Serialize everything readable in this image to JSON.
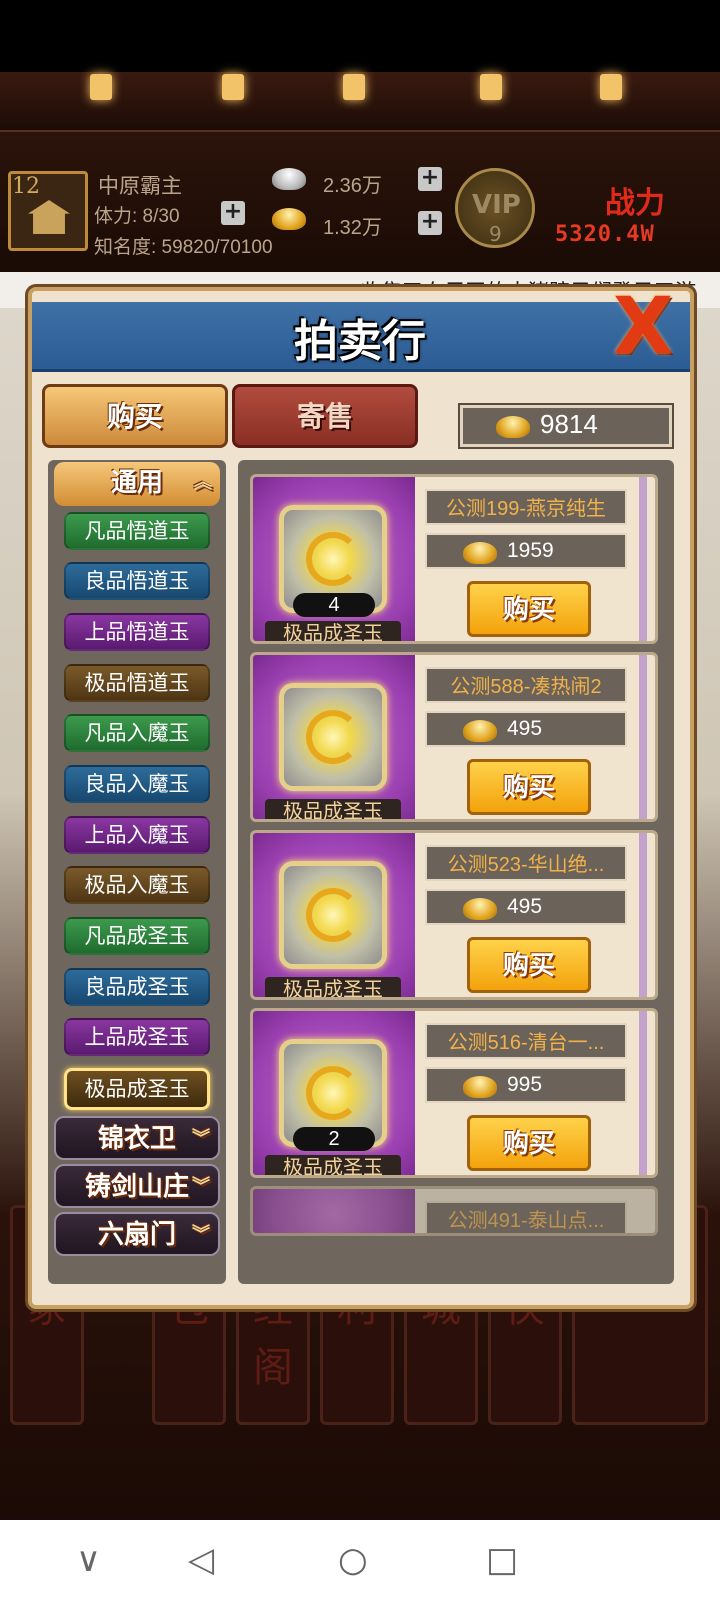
{
  "hud": {
    "level": "12",
    "player_name": "中原霸主",
    "stamina": "体力: 8/30",
    "fame": "知名度: 59820/70100",
    "silver": "2.36万",
    "gold": "1.32万",
    "vip_label": "VIP",
    "vip_level": "9",
    "power_label": "战力",
    "power_value": "5320.4W"
  },
  "ticker": "收集了血尸玉的大猪蹄子们登录了游",
  "panel": {
    "title": "拍卖行",
    "close": "X",
    "tab_buy": "购买",
    "tab_sell": "寄售",
    "balance": "9814"
  },
  "categories": {
    "general": "通用",
    "items": [
      "凡品悟道玉",
      "良品悟道玉",
      "上品悟道玉",
      "极品悟道玉",
      "凡品入魔玉",
      "良品入魔玉",
      "上品入魔玉",
      "极品入魔玉",
      "凡品成圣玉",
      "良品成圣玉",
      "上品成圣玉",
      "极品成圣玉"
    ],
    "jinyiwei": "锦衣卫",
    "zhujian": "铸剑山庄",
    "liushanmen": "六扇门"
  },
  "listings": [
    {
      "seller": "公测199-燕京纯生",
      "price": "1959",
      "qty": "4",
      "name": "极品成圣玉",
      "buy": "购买"
    },
    {
      "seller": "公测588-凑热闹2",
      "price": "495",
      "qty": "",
      "name": "极品成圣玉",
      "buy": "购买"
    },
    {
      "seller": "公测523-华山绝...",
      "price": "495",
      "qty": "",
      "name": "极品成圣玉",
      "buy": "购买"
    },
    {
      "seller": "公测516-清台一...",
      "price": "995",
      "qty": "2",
      "name": "极品成圣玉",
      "buy": "购买"
    },
    {
      "seller": "公测491-泰山点...",
      "price": "",
      "qty": "",
      "name": "",
      "buy": ""
    }
  ],
  "bg_buttons": [
    "剑冢",
    "背包",
    "藏经阁",
    "福利",
    "商城",
    "寻侠",
    "天下"
  ],
  "nav": {
    "back": "◁",
    "home": "○",
    "recent": "□",
    "down": "∨"
  }
}
